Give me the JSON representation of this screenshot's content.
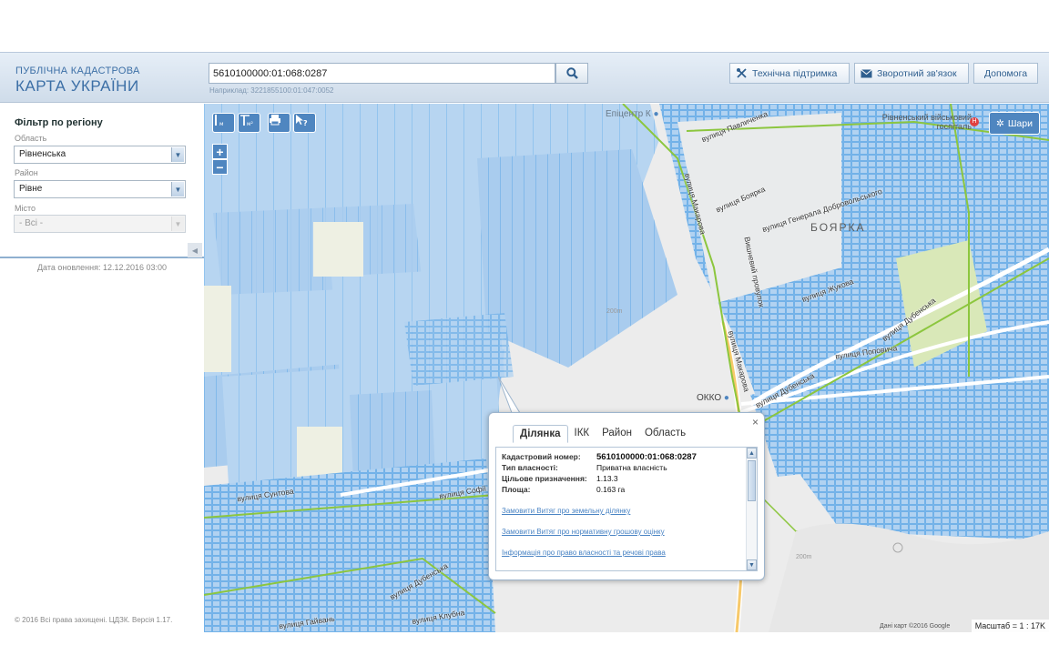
{
  "header": {
    "brand_line1": "ПУБЛІЧНА КАДАСТРОВА",
    "brand_line2": "КАРТА УКРАЇНИ",
    "search_value": "5610100000:01:068:0287",
    "search_hint": "Наприклад: 3221855100:01:047:0052",
    "support_label": "Технічна підтримка",
    "feedback_label": "Зворотний зв'язок",
    "help_label": "Допомога",
    "support_icon": "tools-icon",
    "feedback_icon": "envelope-icon",
    "search_icon": "magnifier-icon"
  },
  "sidebar": {
    "filter_title": "Фільтр по регіону",
    "region_label": "Область",
    "region_value": "Рівненська",
    "district_label": "Район",
    "district_value": "Рівне",
    "city_label": "Місто",
    "city_value": "- Всі -",
    "update_date": "Дата оновлення: 12.12.2016 03:00",
    "copyright": "© 2016 Всі права захищені. ЦДЗК. Версія 1.17."
  },
  "map": {
    "layers_label": "Шари",
    "scale": "Масштаб = 1 : 17K",
    "credits": "Дані карт ©2016 Google",
    "labels": {
      "epicentr": "Епіцентр К",
      "hospital": "Рівненський військовий госпіталь",
      "boyarka": "БОЯРКА",
      "okko": "ОККО",
      "contour1": "200m",
      "contour2": "200m"
    },
    "streets": {
      "pavlychenka": "вулиця Павличенка",
      "makarova": "вулиця Макарова",
      "boyarka": "вулиця Боярка",
      "dobrovolskoho": "вулиця Генерала Добровольського",
      "vyshnevyi": "Вишневий провулок",
      "zhukova": "вулиця Жукова",
      "dubenska": "вулиця Дубенська",
      "popovycha": "вулиця Поповича",
      "makarova2": "вулиця Макарова",
      "dubenska2": "вулиця Дубенська",
      "suntova": "вулиця Сунтова",
      "sofii": "вулиця Софії",
      "dubenska3": "вулиця Дубенська",
      "klubna": "вулиця Клубна",
      "haivan": "вулиця Гайвань"
    }
  },
  "popup": {
    "tabs": [
      "Ділянка",
      "ІКК",
      "Район",
      "Область"
    ],
    "active_tab": 0,
    "close_glyph": "×",
    "props": [
      {
        "key": "Кадастровий номер:",
        "value": "5610100000:01:068:0287"
      },
      {
        "key": "Тип власності:",
        "value": "Приватна власність"
      },
      {
        "key": "Цільове призначення:",
        "value": "1.13.3"
      },
      {
        "key": "Площа:",
        "value": "0.163 га"
      }
    ],
    "links": [
      "Замовити Витяг про земельну ділянку",
      "Замовити Витяг про нормативну грошову оцінку",
      "Інформація про право власності та речові права"
    ]
  },
  "colors": {
    "accent": "#4f86c0",
    "parcel_fill": "#a9ccee",
    "parcel_stroke": "#5aa6e6",
    "boundary": "#8cc63e"
  }
}
